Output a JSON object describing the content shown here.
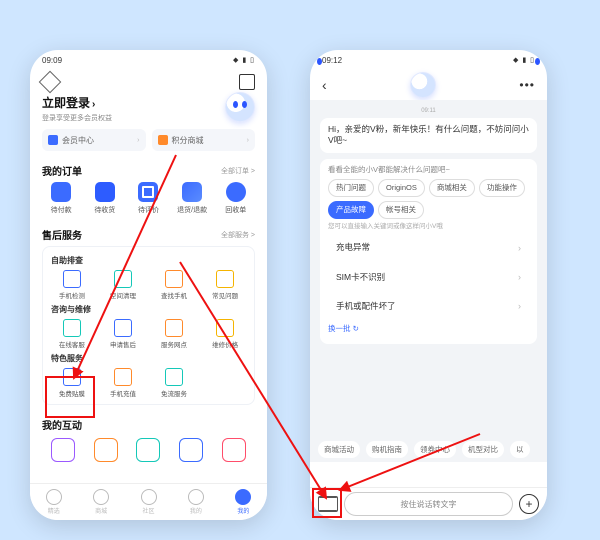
{
  "left": {
    "status_time": "09:09",
    "login_title": "立即登录",
    "login_sub": "登录享受更多会员权益",
    "pill_member": "会员中心",
    "pill_points": "积分商城",
    "orders_title": "我的订单",
    "orders_more": "全部订单 >",
    "orders": [
      "待付款",
      "待收货",
      "待评价",
      "退货/退款",
      "回收单"
    ],
    "aftersale_title": "售后服务",
    "aftersale_more": "全部服务 >",
    "selfcheck_title": "自助排查",
    "selfcheck": [
      "手机检测",
      "空间清理",
      "查找手机",
      "常见问题"
    ],
    "consult_title": "咨询与维修",
    "consult": [
      "在线客服",
      "申请售后",
      "服务网点",
      "维修价格"
    ],
    "special_title": "特色服务",
    "special": [
      "免费贴膜",
      "手机充值",
      "免流服务"
    ],
    "interact_title": "我的互动",
    "nav": [
      "精选",
      "商城",
      "社区",
      "我的",
      "我的"
    ]
  },
  "right": {
    "status_time": "09:12",
    "chat_time": "09:11",
    "greeting": "Hi，亲爱的V粉，新年快乐！有什么问题，不妨问问小V吧~",
    "help_hint": "看看全能的小V都能解决什么问题吧~",
    "tags": [
      "热门问题",
      "OriginOS",
      "商城相关",
      "功能操作",
      "产品故障",
      "帐号相关"
    ],
    "tag_active_index": 4,
    "keyword_hint": "您可以直接输入关键词或像这样问小V哦",
    "questions": [
      "充电异常",
      "SIM卡不识别",
      "手机或配件坏了"
    ],
    "refresh": "换一批 ↻",
    "chips": [
      "商城活动",
      "购机指南",
      "领券中心",
      "机型对比",
      "以"
    ],
    "voice_placeholder": "按住说话转文字"
  }
}
